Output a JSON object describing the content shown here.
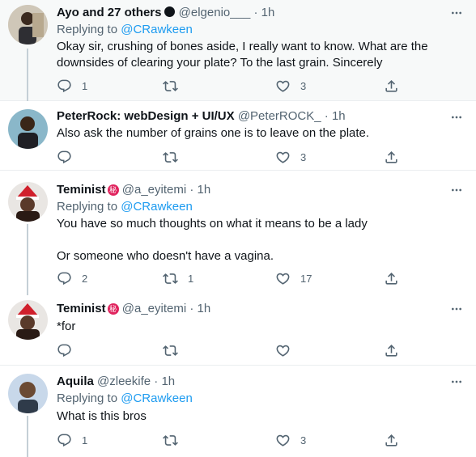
{
  "tweets": [
    {
      "name": "Ayo and 27 others",
      "handle": "@elgenio___",
      "dot": "·",
      "time": "1h",
      "replying_prefix": "Replying to ",
      "replying_to": "@CRawkeen",
      "text": "Okay sir, crushing of bones aside, I really want to know. What are the downsides of clearing your plate? To the last grain. Sincerely",
      "reply_count": "1",
      "retweet_count": "",
      "like_count": "3"
    },
    {
      "name": "PeterRock: webDesign + UI/UX",
      "handle": "@PeterROCK_",
      "dot": "·",
      "time": "1h",
      "text": "Also ask the number of grains one is to leave on the plate.",
      "reply_count": "",
      "retweet_count": "",
      "like_count": "3"
    },
    {
      "name": "Teminist",
      "badge": "秘",
      "handle": "@a_eyitemi",
      "dot": "·",
      "time": "1h",
      "replying_prefix": "Replying to ",
      "replying_to": "@CRawkeen",
      "text": "You have so much thoughts on what it means to be a lady\n\nOr someone who doesn't have a vagina.",
      "reply_count": "2",
      "retweet_count": "1",
      "like_count": "17"
    },
    {
      "name": "Teminist",
      "badge": "秘",
      "handle": "@a_eyitemi",
      "dot": "·",
      "time": "1h",
      "text": "*for",
      "reply_count": "",
      "retweet_count": "",
      "like_count": ""
    },
    {
      "name": "Aquila",
      "handle": "@zleekife",
      "dot": "·",
      "time": "1h",
      "replying_prefix": "Replying to ",
      "replying_to": "@CRawkeen",
      "text": "What is this bros",
      "reply_count": "1",
      "retweet_count": "",
      "like_count": "3"
    }
  ],
  "icons": {
    "reply": "reply-icon",
    "retweet": "retweet-icon",
    "like": "heart-icon",
    "share": "share-icon",
    "more": "more-icon"
  },
  "colors": {
    "link": "#1d9bf0",
    "muted": "#536471",
    "badge": "#e0245e",
    "highlight_bg": "#f7f9f9"
  }
}
